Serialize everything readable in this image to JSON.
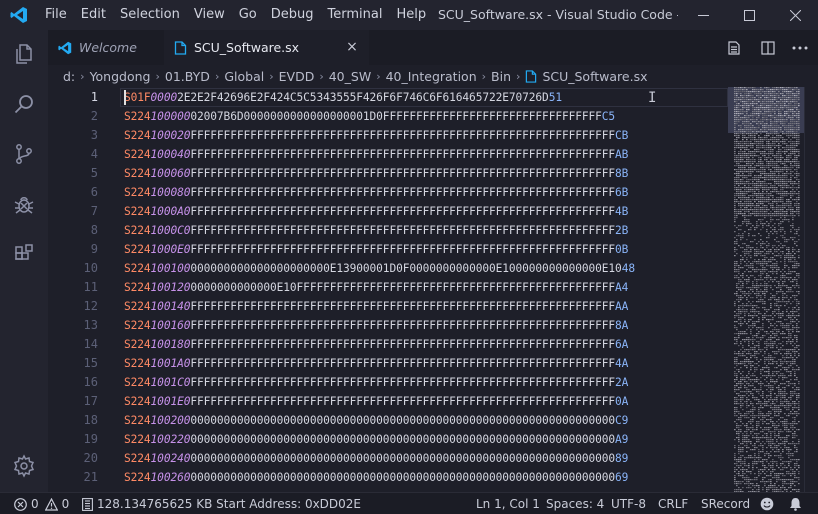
{
  "app": {
    "window_title": "SCU_Software.sx - Visual Studio Code - Insiders",
    "menu": [
      "File",
      "Edit",
      "Selection",
      "View",
      "Go",
      "Debug",
      "Terminal",
      "Help"
    ]
  },
  "tabs": [
    {
      "label": "Welcome",
      "active": false
    },
    {
      "label": "SCU_Software.sx",
      "active": true,
      "close": "×"
    }
  ],
  "breadcrumb": [
    "d:",
    "Yongdong",
    "01.BYD",
    "Global",
    "EVDD",
    "40_SW",
    "40_Integration",
    "Bin",
    "SCU_Software.sx"
  ],
  "editor": {
    "lines": [
      {
        "n": "1",
        "type": "S01F",
        "addr": "0000",
        "data": "2E2E2F42696E2F424C5C5343555F426F6F746C6F616465722E70726D",
        "sum": "51"
      },
      {
        "n": "2",
        "type": "S224",
        "addr": "100000",
        "data": "02007B6D0000000000000000001D0FFFFFFFFFFFFFFFFFFFFFFFFFFFFFFFFF",
        "sum": "C5"
      },
      {
        "n": "3",
        "type": "S224",
        "addr": "100020",
        "data": "FFFFFFFFFFFFFFFFFFFFFFFFFFFFFFFFFFFFFFFFFFFFFFFFFFFFFFFFFFFFFFFF",
        "sum": "CB"
      },
      {
        "n": "4",
        "type": "S224",
        "addr": "100040",
        "data": "FFFFFFFFFFFFFFFFFFFFFFFFFFFFFFFFFFFFFFFFFFFFFFFFFFFFFFFFFFFFFFFF",
        "sum": "AB"
      },
      {
        "n": "5",
        "type": "S224",
        "addr": "100060",
        "data": "FFFFFFFFFFFFFFFFFFFFFFFFFFFFFFFFFFFFFFFFFFFFFFFFFFFFFFFFFFFFFFFF",
        "sum": "8B"
      },
      {
        "n": "6",
        "type": "S224",
        "addr": "100080",
        "data": "FFFFFFFFFFFFFFFFFFFFFFFFFFFFFFFFFFFFFFFFFFFFFFFFFFFFFFFFFFFFFFFF",
        "sum": "6B"
      },
      {
        "n": "7",
        "type": "S224",
        "addr": "1000A0",
        "data": "FFFFFFFFFFFFFFFFFFFFFFFFFFFFFFFFFFFFFFFFFFFFFFFFFFFFFFFFFFFFFFFF",
        "sum": "4B"
      },
      {
        "n": "8",
        "type": "S224",
        "addr": "1000C0",
        "data": "FFFFFFFFFFFFFFFFFFFFFFFFFFFFFFFFFFFFFFFFFFFFFFFFFFFFFFFFFFFFFFFF",
        "sum": "2B"
      },
      {
        "n": "9",
        "type": "S224",
        "addr": "1000E0",
        "data": "FFFFFFFFFFFFFFFFFFFFFFFFFFFFFFFFFFFFFFFFFFFFFFFFFFFFFFFFFFFFFFFF",
        "sum": "0B"
      },
      {
        "n": "10",
        "type": "S224",
        "addr": "100100",
        "data": "000000000000000000000E13900001D0F0000000000000E100000000000000E10",
        "sum": "48"
      },
      {
        "n": "11",
        "type": "S224",
        "addr": "100120",
        "data": "0000000000000E10FFFFFFFFFFFFFFFFFFFFFFFFFFFFFFFFFFFFFFFFFFFFFFFF",
        "sum": "A4"
      },
      {
        "n": "12",
        "type": "S224",
        "addr": "100140",
        "data": "FFFFFFFFFFFFFFFFFFFFFFFFFFFFFFFFFFFFFFFFFFFFFFFFFFFFFFFFFFFFFFFF",
        "sum": "AA"
      },
      {
        "n": "13",
        "type": "S224",
        "addr": "100160",
        "data": "FFFFFFFFFFFFFFFFFFFFFFFFFFFFFFFFFFFFFFFFFFFFFFFFFFFFFFFFFFFFFFFF",
        "sum": "8A"
      },
      {
        "n": "14",
        "type": "S224",
        "addr": "100180",
        "data": "FFFFFFFFFFFFFFFFFFFFFFFFFFFFFFFFFFFFFFFFFFFFFFFFFFFFFFFFFFFFFFFF",
        "sum": "6A"
      },
      {
        "n": "15",
        "type": "S224",
        "addr": "1001A0",
        "data": "FFFFFFFFFFFFFFFFFFFFFFFFFFFFFFFFFFFFFFFFFFFFFFFFFFFFFFFFFFFFFFFF",
        "sum": "4A"
      },
      {
        "n": "16",
        "type": "S224",
        "addr": "1001C0",
        "data": "FFFFFFFFFFFFFFFFFFFFFFFFFFFFFFFFFFFFFFFFFFFFFFFFFFFFFFFFFFFFFFFF",
        "sum": "2A"
      },
      {
        "n": "17",
        "type": "S224",
        "addr": "1001E0",
        "data": "FFFFFFFFFFFFFFFFFFFFFFFFFFFFFFFFFFFFFFFFFFFFFFFFFFFFFFFFFFFFFFFF",
        "sum": "0A"
      },
      {
        "n": "18",
        "type": "S224",
        "addr": "100200",
        "data": "0000000000000000000000000000000000000000000000000000000000000000",
        "sum": "C9"
      },
      {
        "n": "19",
        "type": "S224",
        "addr": "100220",
        "data": "0000000000000000000000000000000000000000000000000000000000000000",
        "sum": "A9"
      },
      {
        "n": "20",
        "type": "S224",
        "addr": "100240",
        "data": "0000000000000000000000000000000000000000000000000000000000000000",
        "sum": "89"
      },
      {
        "n": "21",
        "type": "S224",
        "addr": "100260",
        "data": "0000000000000000000000000000000000000000000000000000000000000000",
        "sum": "69"
      }
    ]
  },
  "statusbar": {
    "errors": "0",
    "warnings": "0",
    "file_info": "128.134765625 KB Start Address: 0xDD02E",
    "position": "Ln 1, Col 1",
    "spaces": "Spaces: 4",
    "encoding": "UTF-8",
    "eol": "CRLF",
    "language": "SRecord"
  },
  "colors": {
    "accent": "#23aaf2",
    "record_type": "#ff8a65",
    "address": "#c792ea",
    "checksum": "#8ab4f8"
  },
  "icons": {
    "app": "vscode-logo-icon",
    "activity": [
      "files-icon",
      "search-icon",
      "source-control-icon",
      "debug-icon",
      "extensions-icon",
      "settings-gear-icon"
    ],
    "tab_actions": [
      "open-preview-icon",
      "split-editor-icon",
      "more-actions-icon"
    ],
    "status": [
      "error-icon",
      "warning-icon",
      "file-binary-icon",
      "feedback-smiley-icon",
      "bell-icon"
    ]
  }
}
